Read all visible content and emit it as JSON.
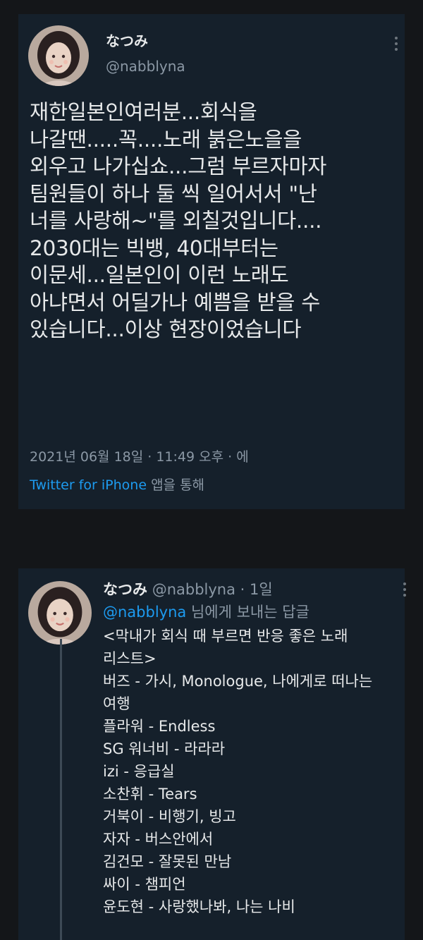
{
  "tweet": {
    "display_name": "なつみ",
    "handle": "@nabblyna",
    "avatar_icon": "user-avatar-icon",
    "more_icon": "more-options-icon",
    "text_lines": [
      "재한일본인여러분...회식을",
      "나갈땐.....꼭....노래 붉은노을을",
      "외우고 나가십쇼...그럼 부르자마자",
      "팀원들이 하나 둘 씩  일어서서 \"난",
      "너를 사랑해~\"를 외칠것입니다....",
      "2030대는 빅뱅, 40대부터는",
      "이문세...일본인이 이런 노래도",
      "아냐면서 어딜가나 예쁨을 받을 수",
      "있습니다...이상 현장이었습니다"
    ],
    "timestamp": "2021년 06월 18일 · 11:49 오후 · 에",
    "via_link": "Twitter for iPhone",
    "via_suffix": " 앱을 통해"
  },
  "reply": {
    "display_name": "なつみ",
    "handle": "@nabblyna",
    "separator": "·",
    "time_ago": "1일",
    "replying_mention": "@nabblyna",
    "replying_suffix": " 님에게 보내는 답글",
    "avatar_icon": "user-avatar-icon",
    "more_icon": "more-options-icon",
    "text_lines": [
      "<막내가 회식 때 부르면 반응 좋은 노래",
      "리스트>",
      "버즈 - 가시, Monologue, 나에게로 떠나는",
      "여행",
      "플라워 - Endless",
      "SG 워너비 - 라라라",
      "izi - 응급실",
      "소찬휘 - Tears",
      "거북이 - 비행기, 빙고",
      "자자 - 버스안에서",
      "김건모 - 잘못된 만남",
      "싸이 - 챔피언",
      "윤도현 - 사랑했나봐, 나는 나비"
    ]
  },
  "colors": {
    "page_background": "#141619",
    "card_background": "#15202b",
    "primary_text": "#e7e9ea",
    "secondary_text": "#8b98a5",
    "link_blue": "#1d9bf0"
  }
}
